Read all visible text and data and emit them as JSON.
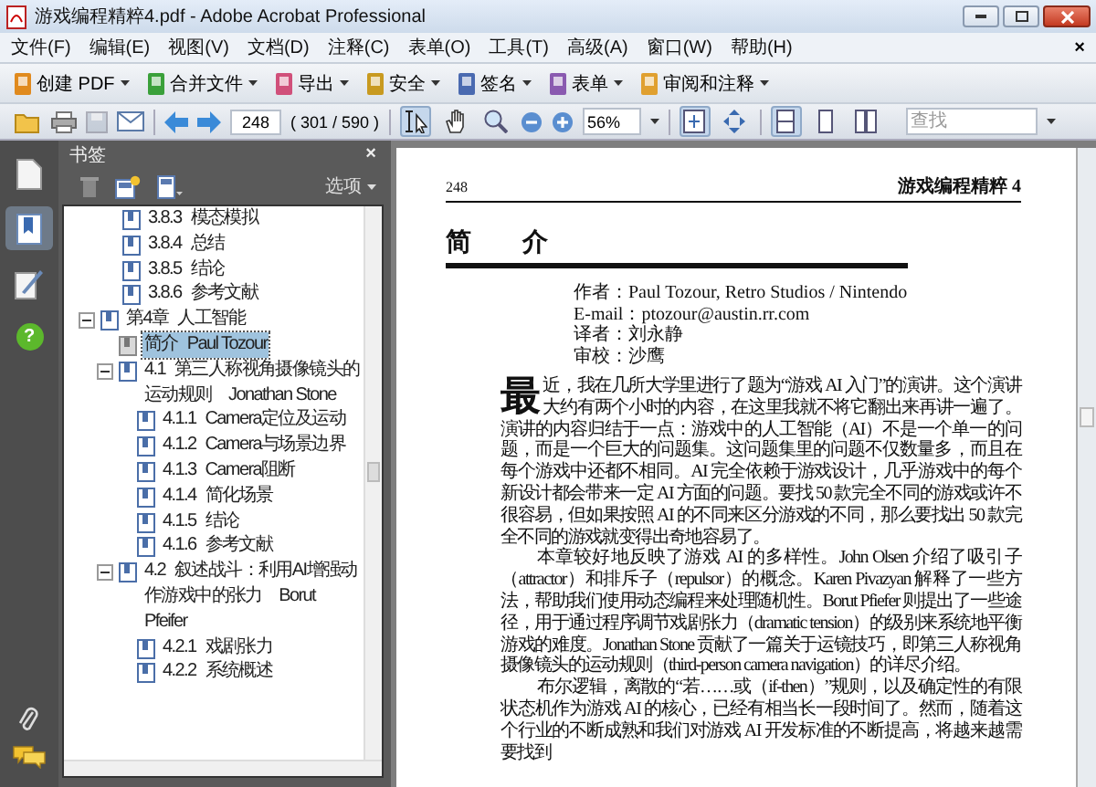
{
  "window": {
    "title": "游戏编程精粹4.pdf - Adobe Acrobat Professional"
  },
  "menu": [
    "文件(F)",
    "编辑(E)",
    "视图(V)",
    "文档(D)",
    "注释(C)",
    "表单(O)",
    "工具(T)",
    "高级(A)",
    "窗口(W)",
    "帮助(H)"
  ],
  "menu_close": "×",
  "task_buttons": [
    {
      "kind": "create",
      "label": "创建 PDF"
    },
    {
      "kind": "combine",
      "label": "合并文件"
    },
    {
      "kind": "export",
      "label": "导出"
    },
    {
      "kind": "secure",
      "label": "安全"
    },
    {
      "kind": "sign",
      "label": "签名"
    },
    {
      "kind": "form",
      "label": "表单"
    },
    {
      "kind": "review",
      "label": "审阅和注释"
    }
  ],
  "toolbar": {
    "save_disabled": true,
    "page_number": "248",
    "page_count": "( 301 / 590 )",
    "zoom": "56%",
    "search_placeholder": "查找",
    "tools": [
      {
        "selected": true
      },
      {
        "selected": false
      },
      {
        "selected": false
      }
    ],
    "fit": [
      {
        "selected": true
      },
      {
        "selected": false
      }
    ],
    "layout": [
      {
        "selected": true
      },
      {
        "selected": false
      },
      {
        "selected": false
      }
    ]
  },
  "side_tabs": [
    {
      "selected": false
    },
    {
      "selected": true
    },
    {
      "selected": false
    },
    {
      "selected": false
    }
  ],
  "help_mark": "?",
  "bookmarks": {
    "title": "书签",
    "close": "×",
    "options": "选项",
    "partial_items": [
      {
        "number": "3.8.3",
        "label": "模态模拟"
      },
      {
        "number": "3.8.4",
        "label": "总结"
      },
      {
        "number": "3.8.5",
        "label": "结论"
      },
      {
        "number": "3.8.6",
        "label": "参考文献"
      }
    ],
    "items": [
      {
        "number": "第4章",
        "label": "人工智能",
        "expanded": true,
        "selected": false,
        "children": [
          {
            "number": "简介",
            "label": "Paul Tozour",
            "selected": true
          },
          {
            "number": "4.1",
            "label": "第三人称视角摄像镜头的运动规则　Jonathan Stone",
            "expanded": true,
            "selected": false,
            "children": [
              {
                "number": "4.1.1",
                "label": "Camera定位及运动",
                "selected": false
              },
              {
                "number": "4.1.2",
                "label": "Camera与场景边界",
                "selected": false
              },
              {
                "number": "4.1.3",
                "label": "Camera阻断",
                "selected": false
              },
              {
                "number": "4.1.4",
                "label": "简化场景",
                "selected": false
              },
              {
                "number": "4.1.5",
                "label": "结论",
                "selected": false
              },
              {
                "number": "4.1.6",
                "label": "参考文献",
                "selected": false
              }
            ]
          },
          {
            "number": "4.2",
            "label": "叙述战斗：利用AI增强动作游戏中的张力　Borut Pfeifer",
            "expanded": true,
            "selected": false,
            "children": [
              {
                "number": "4.2.1",
                "label": "戏剧张力",
                "selected": false
              },
              {
                "number": "4.2.2",
                "label": "系统概述",
                "selected": false
              }
            ]
          }
        ]
      }
    ]
  },
  "page": {
    "number": "248",
    "running_head": "游戏编程精粹 4",
    "title": "简　　介",
    "credits": [
      "作者：Paul Tozour, Retro Studios / Nintendo",
      "E-mail：ptozour@austin.rr.com",
      "译者：刘永静",
      "审校：沙鹰"
    ],
    "paragraphs": [
      "最近，我在几所大学里进行了题为“游戏 AI 入门”的演讲。这个演讲大约有两个小时的内容，在这里我就不将它翻出来再讲一遍了。演讲的内容归结于一点：游戏中的人工智能（AI）不是一个单一的问题，而是一个巨大的问题集。这问题集里的问题不仅数量多，而且在每个游戏中还都不相同。AI 完全依赖于游戏设计，几乎游戏中的每个新设计都会带来一定 AI 方面的问题。要找 50 款完全不同的游戏或许不很容易，但如果按照 AI 的不同来区分游戏的不同，那么要找出 50 款完全不同的游戏就变得出奇地容易了。",
      "本章较好地反映了游戏 AI 的多样性。John Olsen 介绍了吸引子（attractor）和排斥子（repulsor）的概念。Karen Pivazyan 解释了一些方法，帮助我们使用动态编程来处理随机性。Borut Pfiefer 则提出了一些途径，用于通过程序调节戏剧张力（dramatic tension）的级别来系统地平衡游戏的难度。Jonathan Stone 贡献了一篇关于运镜技巧，即第三人称视角摄像镜头的运动规则（third-person camera navigation）的详尽介绍。",
      "布尔逻辑，离散的“若……或（if-then）”规则，以及确定性的有限状态机作为游戏 AI 的核心，已经有相当长一段时间了。然而，随着这个行业的不断成熟和我们对游戏 AI 开发标准的不断提高，将越来越需要找到"
    ]
  }
}
